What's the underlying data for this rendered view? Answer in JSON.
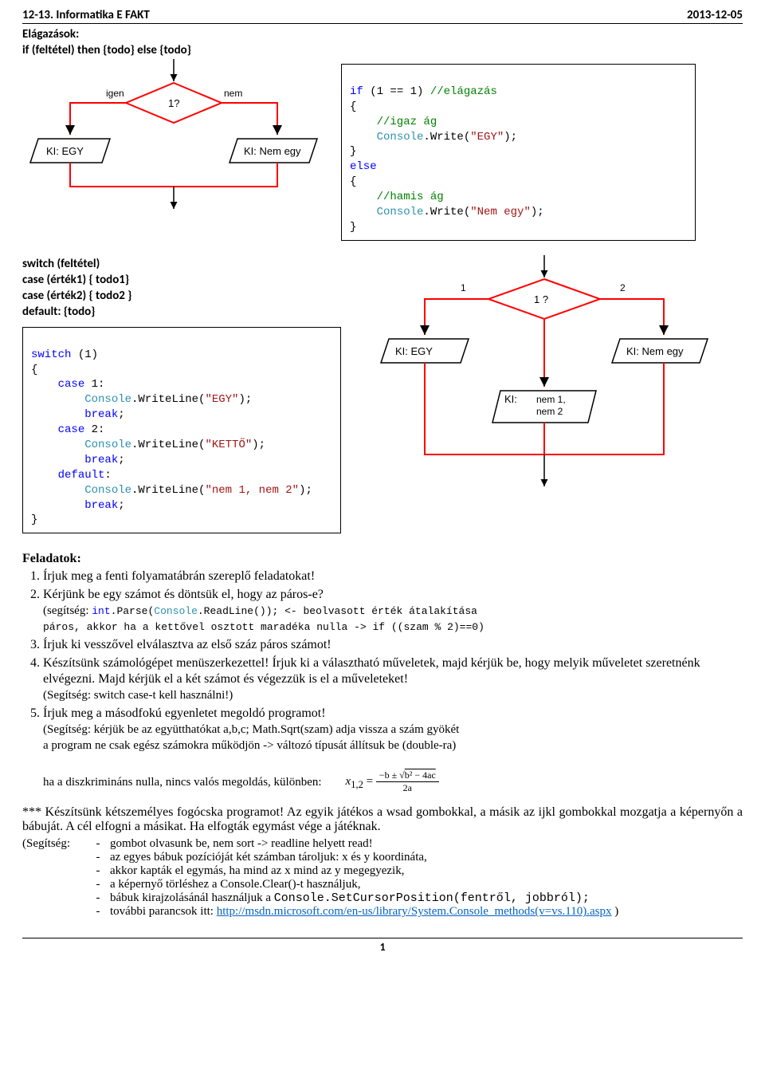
{
  "header": {
    "left": "12-13. Informatika E FAKT",
    "right": "2013-12-05"
  },
  "sec1": {
    "title": "Elágazások:",
    "syntax": "if (feltétel) then {todo} else {todo}"
  },
  "flow1": {
    "igen": "igen",
    "nem": "nem",
    "cond": "1?",
    "out1": "KI: EGY",
    "out2": "KI: Nem egy"
  },
  "code1": {
    "l1a": "if",
    "l1b": " (1 == 1) ",
    "l1c": "//elágazás",
    "l2": "{",
    "l3": "    //igaz ág",
    "l4a": "    ",
    "l4b": "Console",
    "l4c": ".Write(",
    "l4d": "\"EGY\"",
    "l4e": ");",
    "l5": "}",
    "l6": "else",
    "l7": "{",
    "l8": "    //hamis ág",
    "l9a": "    ",
    "l9b": "Console",
    "l9c": ".Write(",
    "l9d": "\"Nem egy\"",
    "l9e": ");",
    "l10": "}"
  },
  "sec2": {
    "syntax1": "switch (feltétel)",
    "syntax2": "case (érték1) { todo1}",
    "syntax3": "case (érték2) { todo2 }",
    "syntax4": "default: {todo}"
  },
  "code2": {
    "l1a": "switch",
    "l1b": " (1)",
    "l2": "{",
    "l3a": "    ",
    "l3b": "case",
    "l3c": " 1:",
    "l4a": "        ",
    "l4b": "Console",
    "l4c": ".WriteLine(",
    "l4d": "\"EGY\"",
    "l4e": ");",
    "l5a": "        ",
    "l5b": "break",
    "l5c": ";",
    "l6a": "    ",
    "l6b": "case",
    "l6c": " 2:",
    "l7a": "        ",
    "l7b": "Console",
    "l7c": ".WriteLine(",
    "l7d": "\"KETTŐ\"",
    "l7e": ");",
    "l8a": "        ",
    "l8b": "break",
    "l8c": ";",
    "l9a": "    ",
    "l9b": "default",
    "l9c": ":",
    "l10a": "        ",
    "l10b": "Console",
    "l10c": ".WriteLine(",
    "l10d": "\"nem 1, nem 2\"",
    "l10e": ");",
    "l11a": "        ",
    "l11b": "break",
    "l11c": ";",
    "l12": "}"
  },
  "flow2": {
    "one": "1",
    "two": "2",
    "cond": "1 ?",
    "out1": "KI: EGY",
    "out2": "KI: Nem egy",
    "out3a": "KI:",
    "out3b": "nem 1,",
    "out3c": "nem 2"
  },
  "tasks": {
    "title": "Feladatok:",
    "t1": "Írjuk meg a fenti folyamatábrán szereplő feladatokat!",
    "t2": "Kérjünk be egy számot és döntsük el, hogy az páros-e?",
    "t2h1": "(segítség: ",
    "t2h2": "int",
    "t2h3": ".Parse(",
    "t2h4": "Console",
    "t2h5": ".ReadLine()); <- beolvasott érték átalakítása",
    "t2h6": "páros, akkor ha a kettővel osztott maradéka nulla -> if ((szam % 2)==0)",
    "t3": "Írjuk ki vesszővel elválasztva az első száz páros számot!",
    "t4a": "Készítsünk számológépet menüszerkezettel! Írjuk ki a választható műveletek, majd kérjük be, hogy melyik műveletet szeretnénk elvégezni. Majd kérjük el a két számot és végezzük is el a műveleteket!",
    "t4b": "(Segítség: switch case-t kell használni!)",
    "t5": "Írjuk meg a másodfokú egyenletet megoldó programot!",
    "t5h1": "(Segítség: kérjük be az együtthatókat a,b,c; Math.Sqrt(szam) adja vissza a szám gyökét",
    "t5h2": "a program ne csak egész számokra működjön -> változó típusát állítsuk be (double-ra)",
    "t5h3": "ha a diszkrimináns nulla, nincs valós megoldás, különben:"
  },
  "formula": {
    "lhs": "x",
    "sub": "1,2",
    "eq": " = ",
    "top1": "−b ± √",
    "top2": "b² − 4ac",
    "bot": "2a"
  },
  "bonus": {
    "p": "*** Készítsünk kétszemélyes fogócska programot! Az egyik játékos a wsad gombokkal, a másik az ijkl gombokkal mozgatja a képernyőn a bábuját. A cél elfogni a másikat. Ha elfogták egymást vége a játéknak."
  },
  "hints": {
    "label": "(Segítség:",
    "h1": "gombot olvasunk be, nem sort -> readline helyett read!",
    "h2": "az egyes bábuk pozícióját két számban tároljuk: x és y koordináta,",
    "h3": "akkor kapták el egymás, ha mind az x mind az y megegyezik,",
    "h4": "a képernyő törléshez a Console.Clear()-t használjuk,",
    "h5a": "bábuk kirajzolásánál használjuk a ",
    "h5b": "Console.SetCursorPosition(fentről, jobbról);",
    "h6a": "további parancsok itt: ",
    "h6b": "http://msdn.microsoft.com/en-us/library/System.Console_methods(v=vs.110).aspx",
    "h6c": " )"
  },
  "footer": {
    "page": "1"
  }
}
